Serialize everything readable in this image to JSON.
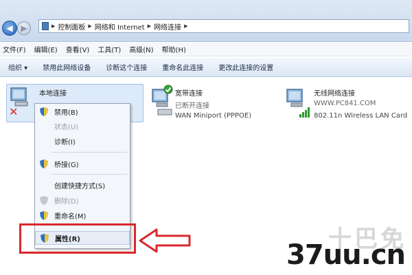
{
  "address_bar": {
    "crumbs": [
      "控制面板",
      "网络和 Internet",
      "网络连接"
    ]
  },
  "menubar": {
    "items": [
      "文件(F)",
      "编辑(E)",
      "查看(V)",
      "工具(T)",
      "高级(N)",
      "帮助(H)"
    ]
  },
  "toolbar": {
    "items": [
      "组织 ▾",
      "禁用此网络设备",
      "诊断这个连接",
      "重命名此连接",
      "更改此连接的设置"
    ]
  },
  "connections": {
    "local": {
      "name": "本地连接"
    },
    "broadband": {
      "name": "宽带连接",
      "status": "已断开连接",
      "device": "WAN Miniport (PPPOE)"
    },
    "wireless": {
      "name": "无线网络连接",
      "status": "WWW.PC841.COM",
      "device": "802.11n Wireless LAN Card"
    }
  },
  "context_menu": {
    "items": [
      {
        "label": "禁用(B)",
        "shield": true,
        "disabled": false
      },
      {
        "label": "状态(U)",
        "shield": false,
        "disabled": true
      },
      {
        "label": "诊断(I)",
        "shield": false,
        "disabled": false
      },
      {
        "label": "桥接(G)",
        "shield": true,
        "disabled": false
      },
      {
        "label": "创建快捷方式(S)",
        "shield": false,
        "disabled": false
      },
      {
        "label": "删除(D)",
        "shield": true,
        "disabled": true
      },
      {
        "label": "重命名(M)",
        "shield": true,
        "disabled": false
      },
      {
        "label": "属性(R)",
        "shield": true,
        "disabled": false
      }
    ]
  },
  "watermark": {
    "text": "37uu.cn",
    "faint": "十巴免"
  },
  "colors": {
    "highlight": "#d9282d",
    "accent": "#1f5fb4"
  }
}
